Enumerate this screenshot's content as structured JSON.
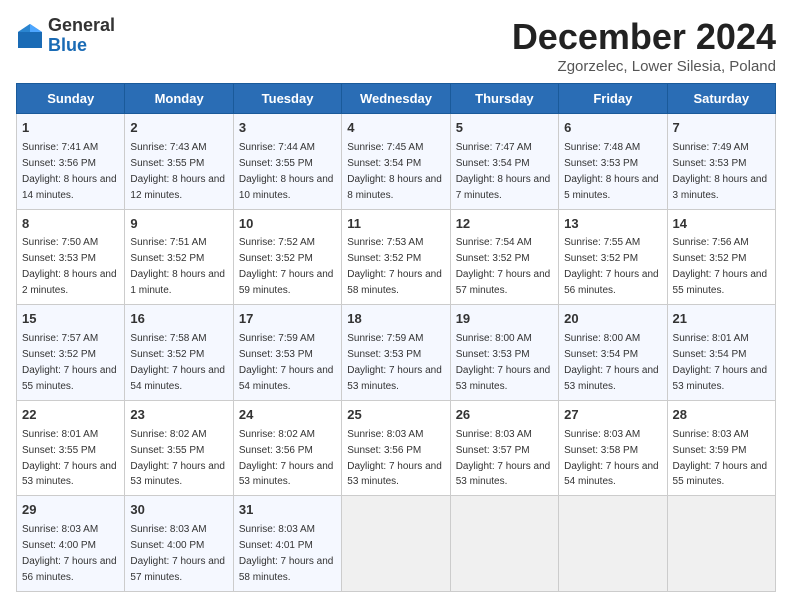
{
  "header": {
    "logo_general": "General",
    "logo_blue": "Blue",
    "month_title": "December 2024",
    "location": "Zgorzelec, Lower Silesia, Poland"
  },
  "weekdays": [
    "Sunday",
    "Monday",
    "Tuesday",
    "Wednesday",
    "Thursday",
    "Friday",
    "Saturday"
  ],
  "weeks": [
    [
      {
        "day": "1",
        "sunrise": "Sunrise: 7:41 AM",
        "sunset": "Sunset: 3:56 PM",
        "daylight": "Daylight: 8 hours and 14 minutes."
      },
      {
        "day": "2",
        "sunrise": "Sunrise: 7:43 AM",
        "sunset": "Sunset: 3:55 PM",
        "daylight": "Daylight: 8 hours and 12 minutes."
      },
      {
        "day": "3",
        "sunrise": "Sunrise: 7:44 AM",
        "sunset": "Sunset: 3:55 PM",
        "daylight": "Daylight: 8 hours and 10 minutes."
      },
      {
        "day": "4",
        "sunrise": "Sunrise: 7:45 AM",
        "sunset": "Sunset: 3:54 PM",
        "daylight": "Daylight: 8 hours and 8 minutes."
      },
      {
        "day": "5",
        "sunrise": "Sunrise: 7:47 AM",
        "sunset": "Sunset: 3:54 PM",
        "daylight": "Daylight: 8 hours and 7 minutes."
      },
      {
        "day": "6",
        "sunrise": "Sunrise: 7:48 AM",
        "sunset": "Sunset: 3:53 PM",
        "daylight": "Daylight: 8 hours and 5 minutes."
      },
      {
        "day": "7",
        "sunrise": "Sunrise: 7:49 AM",
        "sunset": "Sunset: 3:53 PM",
        "daylight": "Daylight: 8 hours and 3 minutes."
      }
    ],
    [
      {
        "day": "8",
        "sunrise": "Sunrise: 7:50 AM",
        "sunset": "Sunset: 3:53 PM",
        "daylight": "Daylight: 8 hours and 2 minutes."
      },
      {
        "day": "9",
        "sunrise": "Sunrise: 7:51 AM",
        "sunset": "Sunset: 3:52 PM",
        "daylight": "Daylight: 8 hours and 1 minute."
      },
      {
        "day": "10",
        "sunrise": "Sunrise: 7:52 AM",
        "sunset": "Sunset: 3:52 PM",
        "daylight": "Daylight: 7 hours and 59 minutes."
      },
      {
        "day": "11",
        "sunrise": "Sunrise: 7:53 AM",
        "sunset": "Sunset: 3:52 PM",
        "daylight": "Daylight: 7 hours and 58 minutes."
      },
      {
        "day": "12",
        "sunrise": "Sunrise: 7:54 AM",
        "sunset": "Sunset: 3:52 PM",
        "daylight": "Daylight: 7 hours and 57 minutes."
      },
      {
        "day": "13",
        "sunrise": "Sunrise: 7:55 AM",
        "sunset": "Sunset: 3:52 PM",
        "daylight": "Daylight: 7 hours and 56 minutes."
      },
      {
        "day": "14",
        "sunrise": "Sunrise: 7:56 AM",
        "sunset": "Sunset: 3:52 PM",
        "daylight": "Daylight: 7 hours and 55 minutes."
      }
    ],
    [
      {
        "day": "15",
        "sunrise": "Sunrise: 7:57 AM",
        "sunset": "Sunset: 3:52 PM",
        "daylight": "Daylight: 7 hours and 55 minutes."
      },
      {
        "day": "16",
        "sunrise": "Sunrise: 7:58 AM",
        "sunset": "Sunset: 3:52 PM",
        "daylight": "Daylight: 7 hours and 54 minutes."
      },
      {
        "day": "17",
        "sunrise": "Sunrise: 7:59 AM",
        "sunset": "Sunset: 3:53 PM",
        "daylight": "Daylight: 7 hours and 54 minutes."
      },
      {
        "day": "18",
        "sunrise": "Sunrise: 7:59 AM",
        "sunset": "Sunset: 3:53 PM",
        "daylight": "Daylight: 7 hours and 53 minutes."
      },
      {
        "day": "19",
        "sunrise": "Sunrise: 8:00 AM",
        "sunset": "Sunset: 3:53 PM",
        "daylight": "Daylight: 7 hours and 53 minutes."
      },
      {
        "day": "20",
        "sunrise": "Sunrise: 8:00 AM",
        "sunset": "Sunset: 3:54 PM",
        "daylight": "Daylight: 7 hours and 53 minutes."
      },
      {
        "day": "21",
        "sunrise": "Sunrise: 8:01 AM",
        "sunset": "Sunset: 3:54 PM",
        "daylight": "Daylight: 7 hours and 53 minutes."
      }
    ],
    [
      {
        "day": "22",
        "sunrise": "Sunrise: 8:01 AM",
        "sunset": "Sunset: 3:55 PM",
        "daylight": "Daylight: 7 hours and 53 minutes."
      },
      {
        "day": "23",
        "sunrise": "Sunrise: 8:02 AM",
        "sunset": "Sunset: 3:55 PM",
        "daylight": "Daylight: 7 hours and 53 minutes."
      },
      {
        "day": "24",
        "sunrise": "Sunrise: 8:02 AM",
        "sunset": "Sunset: 3:56 PM",
        "daylight": "Daylight: 7 hours and 53 minutes."
      },
      {
        "day": "25",
        "sunrise": "Sunrise: 8:03 AM",
        "sunset": "Sunset: 3:56 PM",
        "daylight": "Daylight: 7 hours and 53 minutes."
      },
      {
        "day": "26",
        "sunrise": "Sunrise: 8:03 AM",
        "sunset": "Sunset: 3:57 PM",
        "daylight": "Daylight: 7 hours and 53 minutes."
      },
      {
        "day": "27",
        "sunrise": "Sunrise: 8:03 AM",
        "sunset": "Sunset: 3:58 PM",
        "daylight": "Daylight: 7 hours and 54 minutes."
      },
      {
        "day": "28",
        "sunrise": "Sunrise: 8:03 AM",
        "sunset": "Sunset: 3:59 PM",
        "daylight": "Daylight: 7 hours and 55 minutes."
      }
    ],
    [
      {
        "day": "29",
        "sunrise": "Sunrise: 8:03 AM",
        "sunset": "Sunset: 4:00 PM",
        "daylight": "Daylight: 7 hours and 56 minutes."
      },
      {
        "day": "30",
        "sunrise": "Sunrise: 8:03 AM",
        "sunset": "Sunset: 4:00 PM",
        "daylight": "Daylight: 7 hours and 57 minutes."
      },
      {
        "day": "31",
        "sunrise": "Sunrise: 8:03 AM",
        "sunset": "Sunset: 4:01 PM",
        "daylight": "Daylight: 7 hours and 58 minutes."
      },
      null,
      null,
      null,
      null
    ]
  ]
}
